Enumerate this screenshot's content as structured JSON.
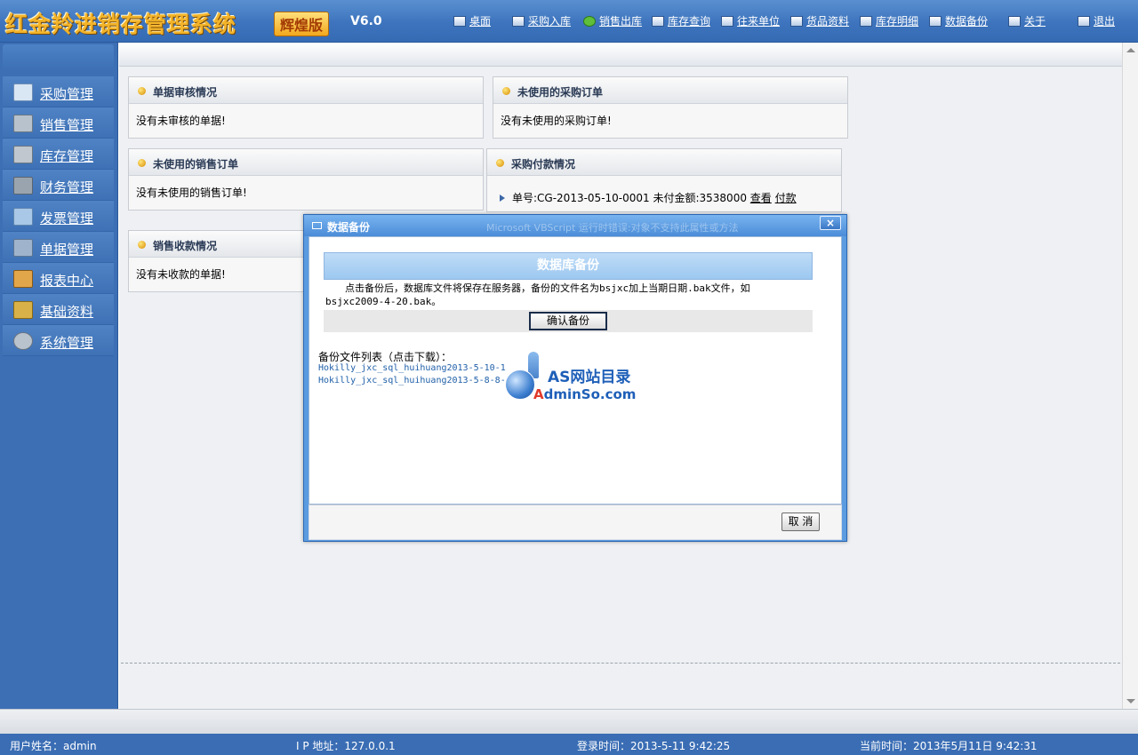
{
  "header": {
    "title": "红金羚进销存管理系统",
    "edition": "辉煌版",
    "version": "V6.0",
    "nav": [
      {
        "label": "桌面",
        "icon": "desktop-icon"
      },
      {
        "label": "采购入库",
        "icon": "purchase-in-icon"
      },
      {
        "label": "销售出库",
        "icon": "refresh-icon"
      },
      {
        "label": "库存查询",
        "icon": "inventory-search-icon"
      },
      {
        "label": "往来单位",
        "icon": "partner-icon"
      },
      {
        "label": "货品资料",
        "icon": "goods-icon"
      },
      {
        "label": "库存明细",
        "icon": "stock-detail-icon"
      },
      {
        "label": "数据备份",
        "icon": "backup-icon"
      },
      {
        "label": "关于",
        "icon": "about-icon"
      },
      {
        "label": "退出",
        "icon": "exit-icon"
      }
    ]
  },
  "sidebar": {
    "items": [
      {
        "label": "采购管理",
        "icon": "purchase-icon",
        "color": "#d9e6f4"
      },
      {
        "label": "销售管理",
        "icon": "cart-icon",
        "color": "#b7c2cc"
      },
      {
        "label": "库存管理",
        "icon": "cart-minus-icon",
        "color": "#c0c7ce"
      },
      {
        "label": "财务管理",
        "icon": "calculator-icon",
        "color": "#9aa4ae"
      },
      {
        "label": "发票管理",
        "icon": "box-icon",
        "color": "#a9c7e6"
      },
      {
        "label": "单据管理",
        "icon": "document-icon",
        "color": "#9fb4cc"
      },
      {
        "label": "报表中心",
        "icon": "truck-icon",
        "color": "#e2a64a"
      },
      {
        "label": "基础资料",
        "icon": "coins-icon",
        "color": "#d8b148"
      },
      {
        "label": "系统管理",
        "icon": "gear-icon",
        "color": "#b9c3cd"
      }
    ]
  },
  "panels": {
    "audit": {
      "title": "单据审核情况",
      "body": "没有未审核的单据!"
    },
    "purchase_orders": {
      "title": "未使用的采购订单",
      "body": "没有未使用的采购订单!"
    },
    "sales_orders": {
      "title": "未使用的销售订单",
      "body": "没有未使用的销售订单!"
    },
    "payments": {
      "title": "采购付款情况",
      "entry_text": "单号:CG-2013-05-10-0001 未付金额:3538000",
      "view_label": "查看",
      "pay_label": "付款"
    },
    "receipts": {
      "title": "销售收款情况",
      "body": "没有未收款的单据!"
    }
  },
  "dialog": {
    "title": "数据备份",
    "error_text": "Microsoft VBScript 运行时错误:对象不支持此属性或方法",
    "close_label": "×",
    "section_title": "数据库备份",
    "note": "　　点击备份后，数据库文件将保存在服务器，备份的文件名为bsjxc加上当期日期.bak文件，如bsjxc2009-4-20.bak。",
    "confirm_label": "确认备份",
    "list_title": "备份文件列表（点击下载）：",
    "files": [
      "Hokilly_jxc_sql_huihuang2013-5-10-1",
      "Hokilly_jxc_sql_huihuang2013-5-8-8-"
    ],
    "cancel_label": "取 消"
  },
  "watermark": {
    "line1": "AS网站目录",
    "line2_a": "A",
    "line2_rest": "dminSo.com"
  },
  "footer": {
    "user_label": "用户姓名：admin",
    "ip_label": "I P 地址：127.0.0.1",
    "login_label": "登录时间：2013-5-11 9:42:25",
    "current_label": "当前时间：2013年5月11日 9:42:31"
  }
}
